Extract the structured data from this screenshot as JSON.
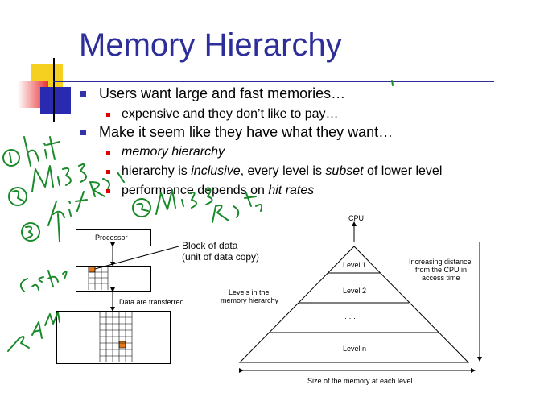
{
  "slide": {
    "title": "Memory Hierarchy",
    "bullets": [
      {
        "text": "Users want large and fast memories…"
      },
      {
        "text": "expensive and they don’t like to pay…"
      },
      {
        "text": "Make it seem like they have what they want…"
      },
      {
        "text": "memory hierarchy"
      },
      {
        "pre": "hierarchy is ",
        "em1": "inclusive",
        "mid": ", every level is ",
        "em2": "subset",
        "post": " of lower level"
      },
      {
        "pre": "performance depends on ",
        "em": "hit rates"
      }
    ]
  },
  "diagram_left": {
    "processor_label": "Processor",
    "block_label_line1": "Block of data",
    "block_label_line2": "(unit of data copy)",
    "transfer_label": "Data are transferred"
  },
  "diagram_right": {
    "cpu_label": "CPU",
    "levels": [
      "Level 1",
      "Level 2",
      "· · ·",
      "Level n"
    ],
    "side_label_line1": "Levels in the",
    "side_label_line2": "memory hierarchy",
    "distance_line1": "Increasing distance",
    "distance_line2": "from the CPU in",
    "distance_line3": "access time",
    "size_label": "Size of the memory at each level"
  },
  "colors": {
    "title": "#2e2e9a",
    "bullet_blue": "#3333aa",
    "bullet_red": "#e00000",
    "ink_green": "#1a8a2a",
    "highlight_orange": "#e07a1a",
    "deco_yellow": "#f5d020",
    "deco_red": "#e83030",
    "deco_blue": "#2a2ab0"
  }
}
